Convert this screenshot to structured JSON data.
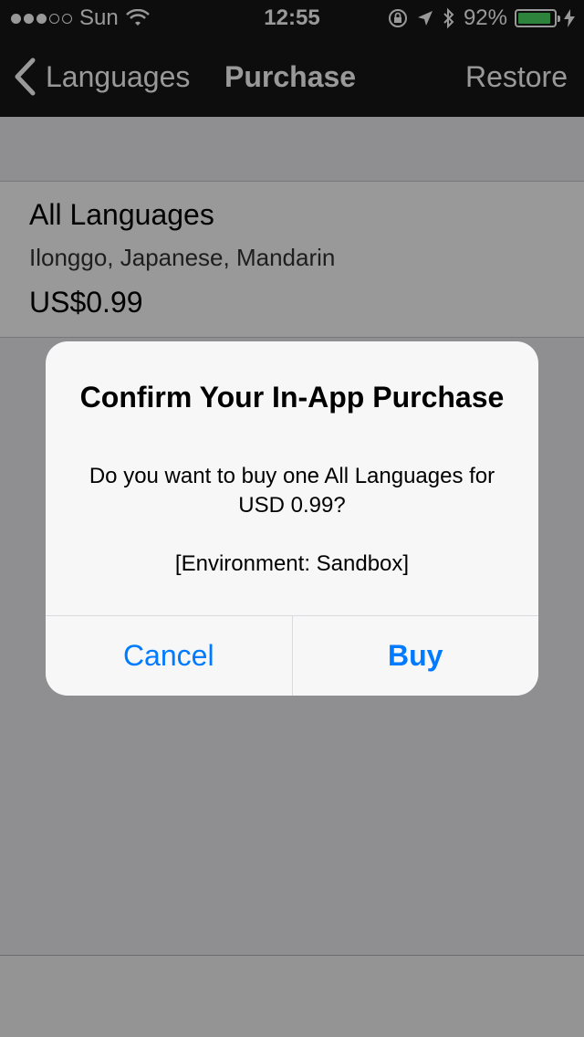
{
  "status_bar": {
    "carrier": "Sun",
    "time": "12:55",
    "battery_percent": "92%",
    "battery_level": 0.92,
    "battery_color": "#4cd964",
    "icons": [
      "signal-dots-icon",
      "wifi-icon",
      "rotation-lock-icon",
      "location-icon",
      "bluetooth-icon",
      "battery-icon",
      "charging-bolt-icon"
    ]
  },
  "nav": {
    "back_label": "Languages",
    "title": "Purchase",
    "right_label": "Restore"
  },
  "product": {
    "title": "All Languages",
    "subtitle": "Ilonggo, Japanese, Mandarin",
    "price": "US$0.99"
  },
  "alert": {
    "title": "Confirm Your In-App Purchase",
    "message": "Do you want to buy one All Languages for USD 0.99?",
    "environment": "[Environment: Sandbox]",
    "cancel_label": "Cancel",
    "buy_label": "Buy",
    "accent_color": "#007aff"
  }
}
